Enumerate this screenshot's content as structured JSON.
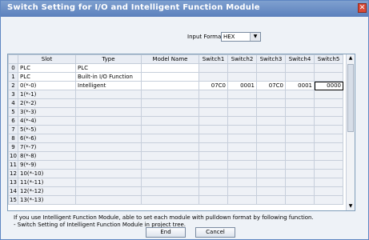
{
  "window": {
    "title": "Switch Setting for I/O and Intelligent Function Module"
  },
  "input_format": {
    "label": "Input Format",
    "value": "HEX"
  },
  "grid": {
    "headers": [
      "",
      "Slot",
      "Type",
      "Model Name",
      "Switch1",
      "Switch2",
      "Switch3",
      "Switch4",
      "Switch5"
    ],
    "rows": [
      {
        "idx": "0",
        "slot": "PLC",
        "type": "PLC",
        "model": "",
        "s1": "",
        "s2": "",
        "s3": "",
        "s4": "",
        "s5": ""
      },
      {
        "idx": "1",
        "slot": "PLC",
        "type": "Built-in I/O Function",
        "model": "",
        "s1": "",
        "s2": "",
        "s3": "",
        "s4": "",
        "s5": ""
      },
      {
        "idx": "2",
        "slot": "0(*-0)",
        "type": "Intelligent",
        "model": "",
        "s1": "07C0",
        "s2": "0001",
        "s3": "07C0",
        "s4": "0001",
        "s5": "0000"
      },
      {
        "idx": "3",
        "slot": "1(*-1)",
        "type": "",
        "model": "",
        "s1": "",
        "s2": "",
        "s3": "",
        "s4": "",
        "s5": ""
      },
      {
        "idx": "4",
        "slot": "2(*-2)",
        "type": "",
        "model": "",
        "s1": "",
        "s2": "",
        "s3": "",
        "s4": "",
        "s5": ""
      },
      {
        "idx": "5",
        "slot": "3(*-3)",
        "type": "",
        "model": "",
        "s1": "",
        "s2": "",
        "s3": "",
        "s4": "",
        "s5": ""
      },
      {
        "idx": "6",
        "slot": "4(*-4)",
        "type": "",
        "model": "",
        "s1": "",
        "s2": "",
        "s3": "",
        "s4": "",
        "s5": ""
      },
      {
        "idx": "7",
        "slot": "5(*-5)",
        "type": "",
        "model": "",
        "s1": "",
        "s2": "",
        "s3": "",
        "s4": "",
        "s5": ""
      },
      {
        "idx": "8",
        "slot": "6(*-6)",
        "type": "",
        "model": "",
        "s1": "",
        "s2": "",
        "s3": "",
        "s4": "",
        "s5": ""
      },
      {
        "idx": "9",
        "slot": "7(*-7)",
        "type": "",
        "model": "",
        "s1": "",
        "s2": "",
        "s3": "",
        "s4": "",
        "s5": ""
      },
      {
        "idx": "10",
        "slot": "8(*-8)",
        "type": "",
        "model": "",
        "s1": "",
        "s2": "",
        "s3": "",
        "s4": "",
        "s5": ""
      },
      {
        "idx": "11",
        "slot": "9(*-9)",
        "type": "",
        "model": "",
        "s1": "",
        "s2": "",
        "s3": "",
        "s4": "",
        "s5": ""
      },
      {
        "idx": "12",
        "slot": "10(*-10)",
        "type": "",
        "model": "",
        "s1": "",
        "s2": "",
        "s3": "",
        "s4": "",
        "s5": ""
      },
      {
        "idx": "13",
        "slot": "11(*-11)",
        "type": "",
        "model": "",
        "s1": "",
        "s2": "",
        "s3": "",
        "s4": "",
        "s5": ""
      },
      {
        "idx": "14",
        "slot": "12(*-12)",
        "type": "",
        "model": "",
        "s1": "",
        "s2": "",
        "s3": "",
        "s4": "",
        "s5": ""
      },
      {
        "idx": "15",
        "slot": "13(*-13)",
        "type": "",
        "model": "",
        "s1": "",
        "s2": "",
        "s3": "",
        "s4": "",
        "s5": ""
      }
    ]
  },
  "description": {
    "line1": "If you use Intelligent Function Module, able to set each module with pulldown format by following function.",
    "line2": "- Switch Setting of Intelligent Function Module in project tree."
  },
  "buttons": {
    "end": "End",
    "cancel": "Cancel"
  },
  "icons": {
    "close": "close-icon",
    "dropdown": "chevron-down-icon",
    "scroll_up": "triangle-up-icon",
    "scroll_down": "triangle-down-icon"
  }
}
